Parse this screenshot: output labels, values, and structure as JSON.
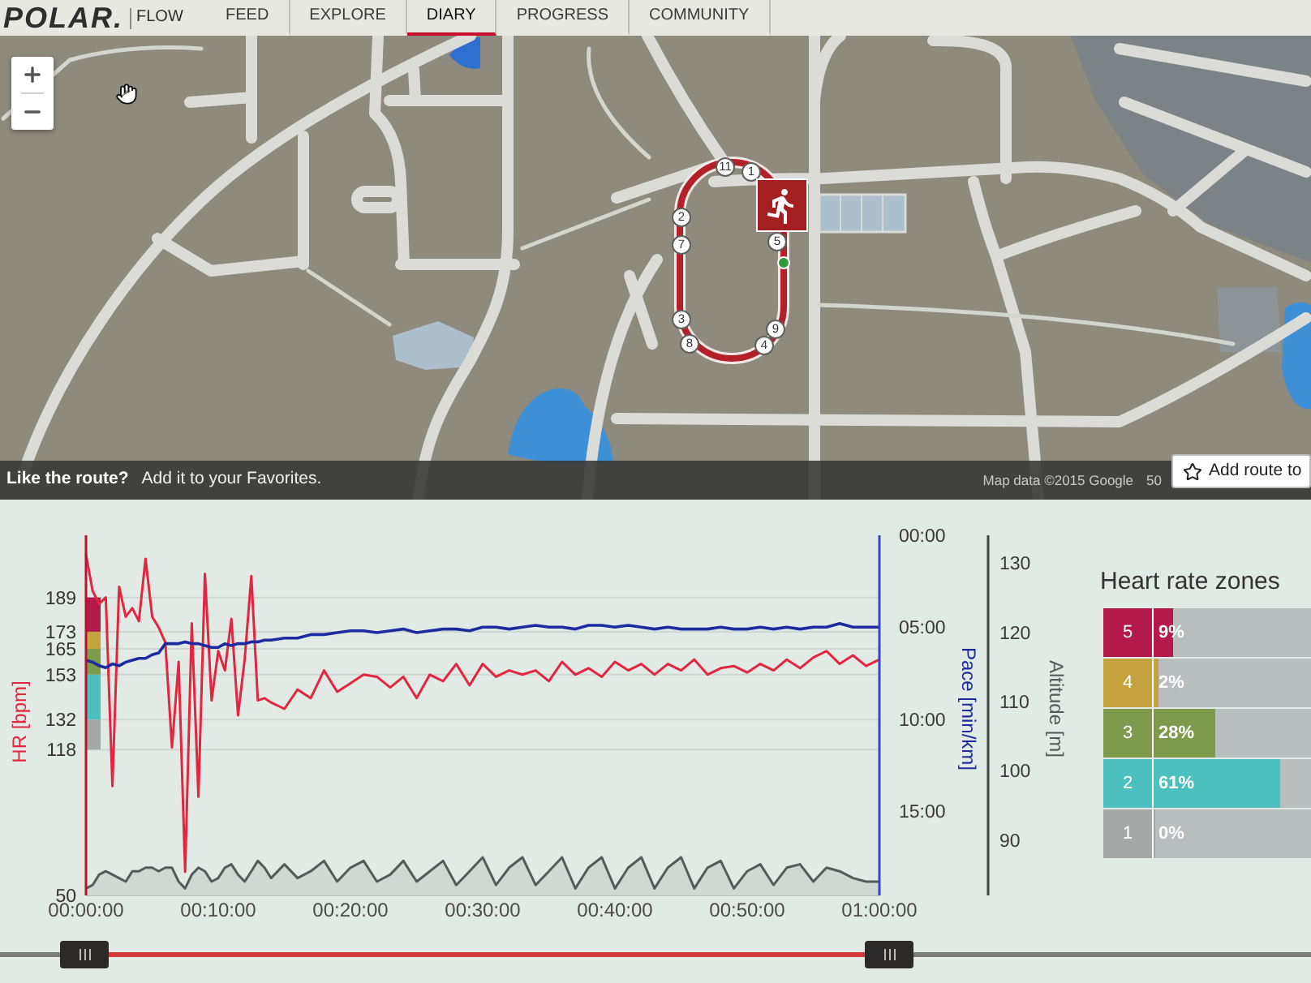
{
  "nav": {
    "brand": "POLAR.",
    "product": "FLOW",
    "items": [
      {
        "label": "FEED",
        "selected": false
      },
      {
        "label": "EXPLORE",
        "selected": false
      },
      {
        "label": "DIARY",
        "selected": true
      },
      {
        "label": "PROGRESS",
        "selected": false
      },
      {
        "label": "COMMUNITY",
        "selected": false
      }
    ]
  },
  "map": {
    "lap_markers": [
      "11",
      "1",
      "2",
      "7",
      "3",
      "8",
      "4",
      "9",
      "5"
    ],
    "bar": {
      "question": "Like the route?",
      "text": "Add it to your Favorites.",
      "attribution": "Map data ©2015 Google",
      "scale": "50"
    },
    "favorite_button": "Add route to"
  },
  "chart": {
    "chart_data": {
      "type": "line",
      "grid": true,
      "ylabel": "HR [bpm]",
      "y2label": "Pace [min/km]",
      "y3label": "Altitude [m]",
      "xlim": [
        0,
        60
      ],
      "ylim": [
        50,
        218
      ],
      "y2lim": [
        19.6,
        0
      ],
      "y3lim": [
        82,
        134
      ],
      "yticks": [
        50,
        118,
        132,
        153,
        165,
        173,
        189
      ],
      "y2ticks": [
        {
          "value": 0,
          "label": "00:00"
        },
        {
          "value": 5,
          "label": "05:00"
        },
        {
          "value": 10,
          "label": "10:00"
        },
        {
          "value": 15,
          "label": "15:00"
        }
      ],
      "y3ticks": [
        90,
        100,
        110,
        120,
        130
      ],
      "xticks": [
        {
          "value": 0,
          "label": "00:00:00"
        },
        {
          "value": 10,
          "label": "00:10:00"
        },
        {
          "value": 20,
          "label": "00:20:00"
        },
        {
          "value": 30,
          "label": "00:30:00"
        },
        {
          "value": 40,
          "label": "00:40:00"
        },
        {
          "value": 50,
          "label": "00:50:00"
        },
        {
          "value": 60,
          "label": "01:00:00"
        }
      ],
      "x": [
        0,
        0.5,
        1,
        1.5,
        2,
        2.5,
        3,
        3.5,
        4,
        4.5,
        5,
        5.5,
        6,
        6.5,
        7,
        7.5,
        8,
        8.5,
        9,
        9.5,
        10,
        10.5,
        11,
        11.5,
        12,
        12.5,
        13,
        13.5,
        14,
        15,
        16,
        17,
        18,
        19,
        20,
        21,
        22,
        23,
        24,
        25,
        26,
        27,
        28,
        29,
        30,
        31,
        32,
        33,
        34,
        35,
        36,
        37,
        38,
        39,
        40,
        41,
        42,
        43,
        44,
        45,
        46,
        47,
        48,
        49,
        50,
        51,
        52,
        53,
        54,
        55,
        56,
        57,
        58,
        59,
        60
      ],
      "series": [
        {
          "color": "#e3263f",
          "values": [
            209,
            192,
            186,
            189,
            101,
            194,
            180,
            184,
            178,
            207,
            180,
            175,
            168,
            119,
            159,
            61,
            177,
            96,
            200,
            141,
            164,
            155,
            179,
            134,
            160,
            199,
            141,
            142,
            140,
            137,
            146,
            142,
            155,
            145,
            149,
            153,
            152,
            147,
            152,
            142,
            153,
            150,
            158,
            148,
            158,
            152,
            155,
            153,
            155,
            150,
            159,
            153,
            156,
            152,
            159,
            155,
            158,
            153,
            158,
            155,
            160,
            153,
            156,
            157,
            154,
            158,
            155,
            160,
            156,
            161,
            164,
            158,
            162,
            157,
            160
          ]
        },
        {
          "axis": "y2",
          "color": "#1c2c9e",
          "values": [
            6.8,
            6.9,
            7.1,
            7.2,
            7.0,
            7.1,
            6.9,
            6.8,
            6.7,
            6.7,
            6.5,
            6.4,
            5.9,
            5.9,
            5.9,
            5.8,
            5.9,
            5.9,
            6.0,
            6.1,
            6.1,
            5.9,
            6.0,
            5.9,
            5.9,
            5.8,
            5.8,
            5.7,
            5.7,
            5.6,
            5.6,
            5.4,
            5.4,
            5.3,
            5.2,
            5.2,
            5.3,
            5.2,
            5.1,
            5.3,
            5.2,
            5.1,
            5.1,
            5.2,
            5.0,
            5.0,
            5.1,
            5.0,
            4.9,
            5.0,
            5.0,
            5.1,
            4.9,
            4.9,
            5.0,
            4.9,
            5.0,
            5.1,
            5.0,
            5.1,
            5.1,
            5.1,
            5.0,
            5.1,
            5.1,
            5.0,
            5.1,
            5.0,
            5.1,
            5.0,
            5.0,
            4.8,
            5.0,
            5.0,
            5.0
          ]
        },
        {
          "axis": "y3",
          "color": "#535c5a",
          "values": [
            83,
            83.5,
            85,
            85.5,
            85,
            84.5,
            84,
            85.5,
            85.5,
            86,
            86,
            85.5,
            86,
            86,
            84,
            83,
            85,
            86,
            85.5,
            84,
            84.5,
            86,
            86.5,
            85,
            84,
            85.5,
            87,
            86,
            84.5,
            86.5,
            84.5,
            85.5,
            87,
            84,
            86,
            87,
            84,
            85,
            87,
            84,
            85.5,
            87,
            83.5,
            85.5,
            87.5,
            83.5,
            86,
            87.5,
            83.5,
            85.5,
            87.5,
            83,
            86,
            87.5,
            83,
            86,
            87.5,
            83,
            86,
            87.5,
            83,
            86,
            87,
            83,
            85.5,
            86.5,
            83.5,
            86,
            86.5,
            84,
            86,
            85.5,
            84.5,
            84,
            84
          ]
        }
      ]
    }
  },
  "heart_rate_zones": {
    "title": "Heart rate zones",
    "zones": [
      {
        "zone": "5",
        "percent": "9%",
        "level": 0.12,
        "color": "#b3194a"
      },
      {
        "zone": "4",
        "percent": "2%",
        "level": 0.03,
        "color": "#c4a33e"
      },
      {
        "zone": "3",
        "percent": "28%",
        "level": 0.39,
        "color": "#7f9a4c"
      },
      {
        "zone": "2",
        "percent": "61%",
        "level": 0.8,
        "color": "#4cbfbf"
      },
      {
        "zone": "1",
        "percent": "0%",
        "level": 0,
        "color": "#a4a9a8"
      }
    ]
  },
  "range_slider": {
    "level": 0.629
  }
}
